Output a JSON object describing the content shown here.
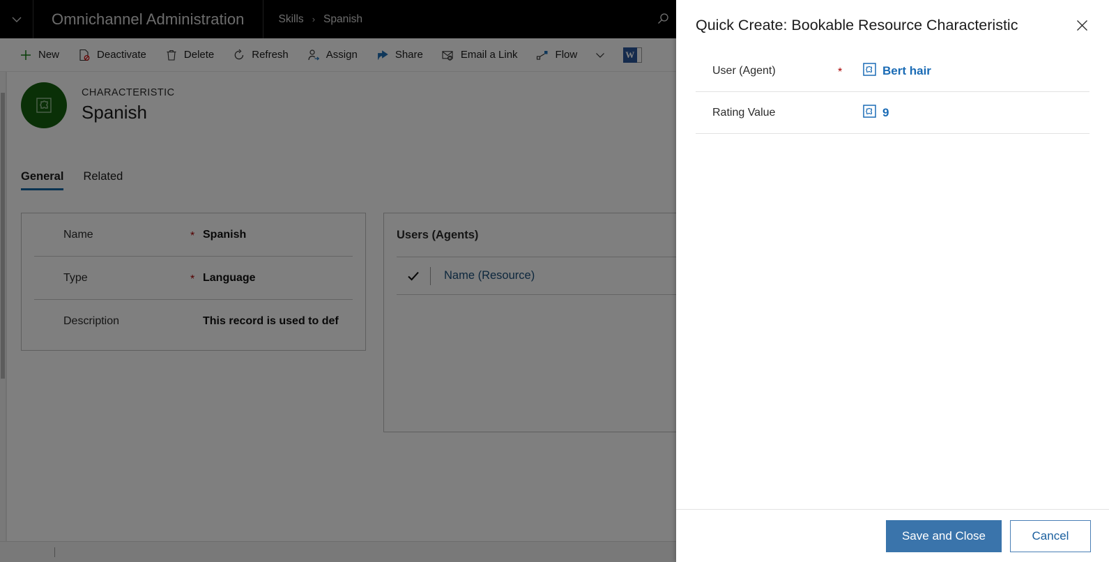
{
  "app": {
    "name": "Omnichannel Administration",
    "nav_chevron_icon": "chevron-down-icon",
    "search_icon": "search-icon"
  },
  "breadcrumb": {
    "parent": "Skills",
    "separator": "›",
    "current": "Spanish"
  },
  "commandbar": {
    "items": [
      {
        "label": "New",
        "icon": "plus-icon"
      },
      {
        "label": "Deactivate",
        "icon": "deactivate-icon"
      },
      {
        "label": "Delete",
        "icon": "trash-icon"
      },
      {
        "label": "Refresh",
        "icon": "refresh-icon"
      },
      {
        "label": "Assign",
        "icon": "assign-person-icon"
      },
      {
        "label": "Share",
        "icon": "share-icon"
      },
      {
        "label": "Email a Link",
        "icon": "email-link-icon"
      },
      {
        "label": "Flow",
        "icon": "flow-icon"
      }
    ],
    "overflow_icon": "chevron-down-icon",
    "word_template_icon": "word-icon",
    "word_template_letter": "W"
  },
  "record": {
    "entity_label": "CHARACTERISTIC",
    "title": "Spanish",
    "avatar_icon": "characteristic-record-icon",
    "avatar_color": "#15610e"
  },
  "tabs": [
    {
      "label": "General",
      "active": true
    },
    {
      "label": "Related",
      "active": false
    }
  ],
  "general_form": {
    "fields": [
      {
        "label": "Name",
        "required": "*",
        "value": "Spanish"
      },
      {
        "label": "Type",
        "required": "*",
        "value": "Language"
      },
      {
        "label": "Description",
        "required": "",
        "value": "This record is used to defin"
      }
    ]
  },
  "subgrid": {
    "title": "Users (Agents)",
    "check_icon": "checkmark-icon",
    "rows": [
      {
        "link": "Name (Resource)"
      }
    ]
  },
  "statusbar": {
    "left_text": "",
    "right_text": ""
  },
  "quick_create": {
    "title": "Quick Create: Bookable Resource Characteristic",
    "close_icon": "close-icon",
    "fields": [
      {
        "label": "User (Agent)",
        "required": "*",
        "lookup_icon": "lookup-record-icon",
        "value": "Bert hair"
      },
      {
        "label": "Rating Value",
        "required": "",
        "lookup_icon": "lookup-record-icon",
        "value": "9"
      }
    ],
    "primary_button": "Save and Close",
    "secondary_button": "Cancel"
  },
  "colors": {
    "topbar_background": "#000000",
    "scrim": "rgba(0,0,0,0.50)",
    "primary_button": "#3a74ab",
    "link": "#1a6bb5",
    "required_asterisk": "#a80000",
    "tab_underline": "#1264a3",
    "avatar_green": "#15610e"
  }
}
